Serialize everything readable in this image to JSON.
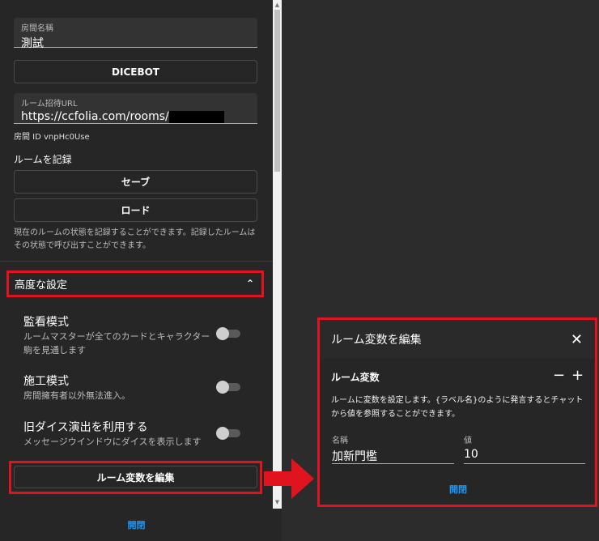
{
  "settings_panel": {
    "room_name": {
      "label": "房間名稱",
      "value": "測試"
    },
    "dicebot_button": "DICEBOT",
    "invite_url": {
      "label": "ルーム招待URL",
      "value": "https://ccfolia.com/rooms/"
    },
    "room_id": "房間 ID vnpHc0Use",
    "record_heading": "ルームを記録",
    "save_button": "セーブ",
    "load_button": "ロード",
    "record_description": "現在のルームの状態を記録することができます。記録したルームはその状態で呼び出すことができます。",
    "advanced_settings": "高度な設定",
    "settings": [
      {
        "title": "監看模式",
        "description": "ルームマスターが全てのカードとキャラクター駒を見通します",
        "enabled": false
      },
      {
        "title": "施工模式",
        "description": "房間擁有者以外無法進入。",
        "enabled": false
      },
      {
        "title": "旧ダイス演出を利用する",
        "description": "メッセージウインドウにダイスを表示します",
        "enabled": false
      }
    ],
    "edit_variables_button": "ルーム変数を編集",
    "toggle_link": "開閉"
  },
  "variables_dialog": {
    "title": "ルーム変数を編集",
    "section_title": "ルーム変数",
    "description": "ルームに変数を設定します。{ラベル名}のように発言するとチャットから値を参照することができます。",
    "name_label": "名稱",
    "name_value": "加新門檻",
    "value_label": "値",
    "value_value": "10",
    "toggle_link": "開閉"
  },
  "colors": {
    "highlight": "#e0141e",
    "link": "#2196f3"
  }
}
